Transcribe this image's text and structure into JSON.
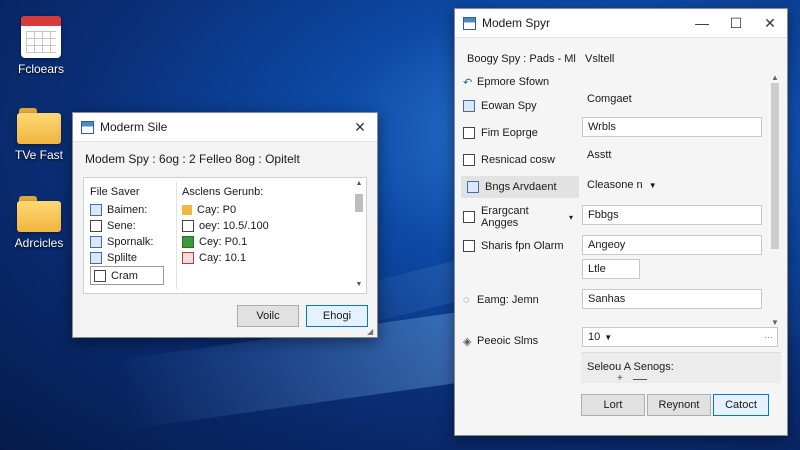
{
  "desktop": {
    "icons": [
      {
        "label": "Fcloears",
        "type": "calendar-icon"
      },
      {
        "label": "TVe Fast",
        "type": "folder-icon"
      },
      {
        "label": "Adrcicles",
        "type": "folder-icon"
      }
    ]
  },
  "dialog": {
    "title": "Moderm Sile",
    "heading": "Modem Spy : 6og : 2 Felleo 8og : Opitelt",
    "left_header": "File Saver",
    "left_items": [
      "Baimen:",
      "Sene:",
      "Spornalk:",
      "Splilte",
      "Cram"
    ],
    "right_header": "Asclens Gerunb:",
    "right_items": [
      "Cay: P0",
      "oey: 10.5/.100",
      "Cey: P0.1",
      "Cay: 10.1"
    ],
    "buttons": {
      "left": "Voilc",
      "right": "Ehogi"
    }
  },
  "main_window": {
    "title": "Modem Spyr",
    "nav_header": "Boogy Spy : Pads - Ml",
    "nav_items": [
      {
        "label": "Epmore Sfown",
        "icon": "back-arrow-icon"
      },
      {
        "label": "Eowan Spy",
        "icon": "clipboard-icon"
      },
      {
        "label": "Fim Eoprge",
        "icon": "checkbox-icon"
      },
      {
        "label": "Resnicad cosw",
        "icon": "checkbox-icon"
      },
      {
        "label": "Bngs Arvdaent",
        "icon": "calendar-icon",
        "selected": true
      },
      {
        "label": "Erargcant Angges",
        "icon": "list-icon",
        "has_chevron": true
      },
      {
        "label": "Sharis fpn Olarm",
        "icon": "list-icon"
      },
      {
        "label": "Eamg: Jemn",
        "icon": "bulb-icon"
      },
      {
        "label": "Peeoic Slms",
        "icon": "diamond-icon"
      }
    ],
    "content_header": "Vsltell",
    "fields": {
      "comgaet_label": "Comgaet",
      "wrbls_value": "Wrbls",
      "asstt_label": "Asstt",
      "cleasone_value": "Cleasone n",
      "fbbgs_value": "Fbbgs",
      "angeoy_value": "Angeoy",
      "ltle_value": "Ltle",
      "sanhas_value": "Sanhas",
      "num_value": "10",
      "section_label": "Seleou A Senogs:"
    },
    "buttons": {
      "lort": "Lort",
      "reyront": "Reynont",
      "catoct": "Catoct"
    },
    "accent_color": "#0078d7"
  }
}
